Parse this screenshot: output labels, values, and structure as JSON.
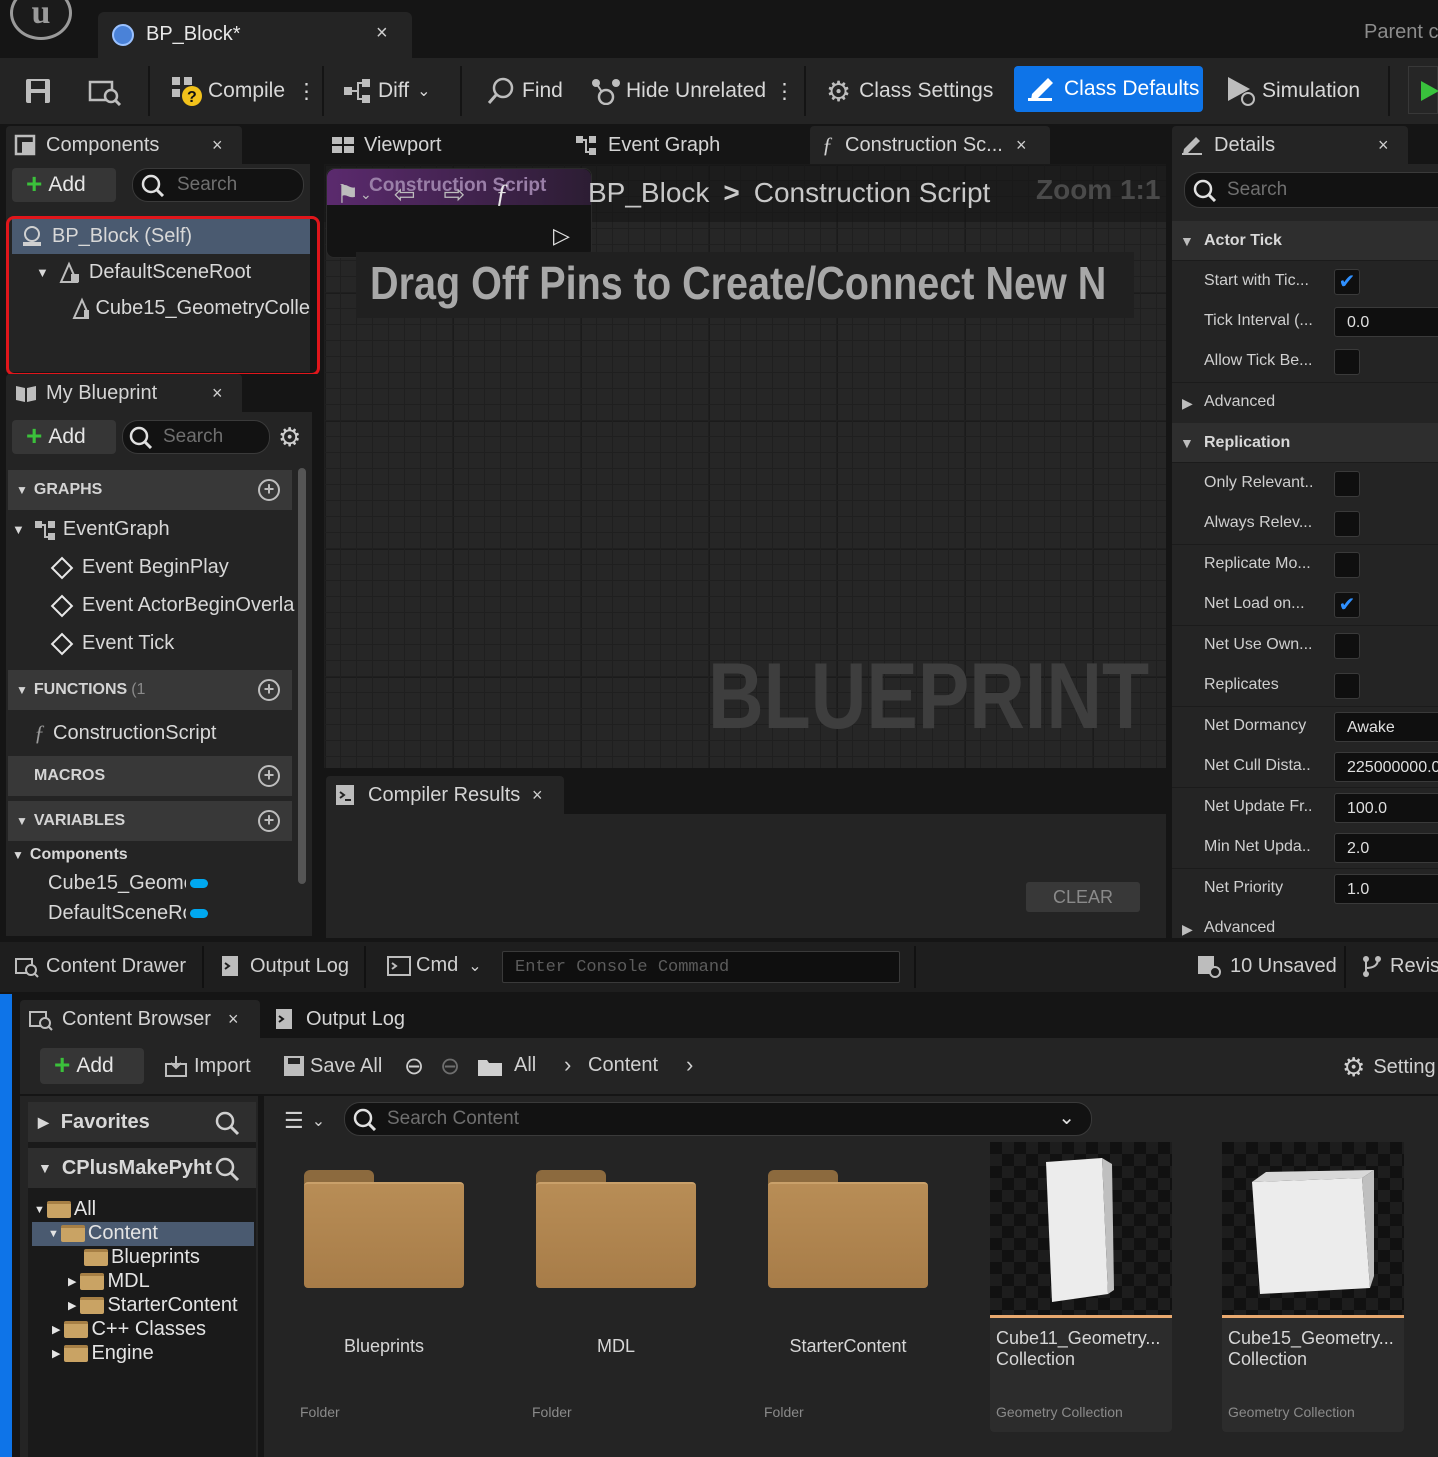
{
  "window": {
    "logo": "u",
    "tab_title": "BP_Block*",
    "tab_close": "×",
    "parent_class_label": "Parent c"
  },
  "toolbar": {
    "compile": "Compile",
    "diff": "Diff",
    "find": "Find",
    "hide_unrelated": "Hide Unrelated",
    "class_settings": "Class Settings",
    "class_defaults": "Class Defaults",
    "simulation": "Simulation"
  },
  "components": {
    "title": "Components",
    "close": "×",
    "add": "Add",
    "search_placeholder": "Search",
    "items": [
      "BP_Block (Self)",
      "DefaultSceneRoot",
      "Cube15_GeometryColle"
    ]
  },
  "my_blueprint": {
    "title": "My Blueprint",
    "close": "×",
    "add": "Add",
    "search_placeholder": "Search",
    "graphs_header": "GRAPHS",
    "event_graph": "EventGraph",
    "events": [
      "Event BeginPlay",
      "Event ActorBeginOverla",
      "Event Tick"
    ],
    "functions_header": "FUNCTIONS",
    "functions_count": "(1",
    "construction_script": "ConstructionScript",
    "macros_header": "MACROS",
    "variables_header": "VARIABLES",
    "components_category": "Components",
    "variables": [
      "Cube15_Geome",
      "DefaultSceneRc"
    ]
  },
  "graph": {
    "tabs": [
      "Viewport",
      "Event Graph",
      "Construction Sc..."
    ],
    "close": "×",
    "breadcrumb_root": "BP_Block",
    "breadcrumb_sep": ">",
    "breadcrumb_leaf": "Construction Script",
    "zoom": "Zoom 1:1",
    "node_title": "Construction Script",
    "hint": "Drag Off Pins to Create/Connect New N",
    "watermark": "BLUEPRINT"
  },
  "compiler": {
    "title": "Compiler Results",
    "close": "×",
    "clear": "CLEAR"
  },
  "details": {
    "title": "Details",
    "close": "×",
    "search_placeholder": "Search",
    "actor_tick": "Actor Tick",
    "start_with_tick": "Start with Tic...",
    "start_with_tick_checked": true,
    "tick_interval": "Tick Interval (...",
    "tick_interval_value": "0.0",
    "allow_tick": "Allow Tick Be...",
    "allow_tick_checked": false,
    "advanced": "Advanced",
    "replication": "Replication",
    "only_relevant": "Only Relevant...",
    "always_relevant": "Always Relev...",
    "replicate_movement": "Replicate Mo...",
    "net_load": "Net Load on...",
    "net_load_checked": true,
    "net_use_owner": "Net Use Own...",
    "replicates": "Replicates",
    "net_dormancy": "Net Dormancy",
    "net_dormancy_value": "Awake",
    "net_cull": "Net Cull Dista...",
    "net_cull_value": "225000000.0",
    "net_update": "Net Update Fr...",
    "net_update_value": "100.0",
    "min_net_update": "Min Net Upda...",
    "min_net_update_value": "2.0",
    "net_priority": "Net Priority",
    "net_priority_value": "1.0",
    "advanced2": "Advanced"
  },
  "statusbar": {
    "content_drawer": "Content Drawer",
    "output_log": "Output Log",
    "cmd": "Cmd",
    "console_placeholder": "Enter Console Command",
    "unsaved": "10 Unsaved",
    "revision": "Revis"
  },
  "content_browser": {
    "tab": "Content Browser",
    "close": "×",
    "output_log_tab": "Output Log",
    "add": "Add",
    "import": "Import",
    "save_all": "Save All",
    "path_all": "All",
    "path_content": "Content",
    "settings": "Setting",
    "favorites": "Favorites",
    "project": "CPlusMakePyht",
    "search_placeholder": "Search Content",
    "tree": [
      "All",
      "Content",
      "Blueprints",
      "MDL",
      "StarterContent",
      "C++ Classes",
      "Engine"
    ],
    "folders": [
      {
        "name": "Blueprints",
        "type": "Folder"
      },
      {
        "name": "MDL",
        "type": "Folder"
      },
      {
        "name": "StarterContent",
        "type": "Folder"
      }
    ],
    "assets": [
      {
        "name_line1": "Cube11_Geometry...",
        "name_line2": "Collection",
        "type": "Geometry Collection"
      },
      {
        "name_line1": "Cube15_Geometry...",
        "name_line2": "Collection",
        "type": "Geometry Collection"
      }
    ]
  },
  "colors": {
    "accent": "#0e74e8",
    "highlight_outline": "#e0161b",
    "selected_row": "#4a5a70",
    "asset_underline": "#e9a96f"
  }
}
